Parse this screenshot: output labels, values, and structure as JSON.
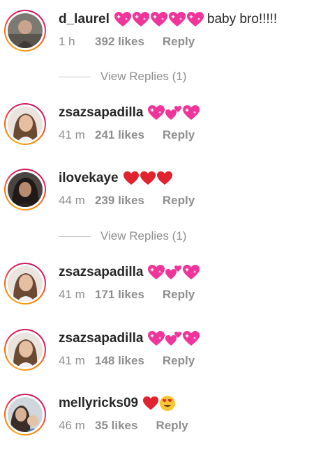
{
  "comments": [
    {
      "username": "d_laurel",
      "text": "baby bro!!!!!",
      "emojis": [
        "sparkling-heart-icon",
        "sparkling-heart-icon",
        "sparkling-heart-icon",
        "sparkling-heart-icon",
        "sparkling-heart-icon"
      ],
      "time": "1 h",
      "likes": "392 likes",
      "reply": "Reply"
    },
    {
      "username": "zsazsapadilla",
      "text": "",
      "emojis": [
        "sparkling-heart-icon",
        "two-hearts-icon",
        "sparkling-heart-icon"
      ],
      "time": "41 m",
      "likes": "241 likes",
      "reply": "Reply"
    },
    {
      "username": "ilovekaye",
      "text": "",
      "emojis": [
        "red-heart-icon",
        "red-heart-icon",
        "red-heart-icon"
      ],
      "time": "44 m",
      "likes": "239 likes",
      "reply": "Reply"
    },
    {
      "username": "zsazsapadilla",
      "text": "",
      "emojis": [
        "sparkling-heart-icon",
        "two-hearts-icon",
        "sparkling-heart-icon"
      ],
      "time": "41 m",
      "likes": "171 likes",
      "reply": "Reply"
    },
    {
      "username": "zsazsapadilla",
      "text": "",
      "emojis": [
        "sparkling-heart-icon",
        "two-hearts-icon",
        "sparkling-heart-icon"
      ],
      "time": "41 m",
      "likes": "148 likes",
      "reply": "Reply"
    },
    {
      "username": "mellyricks09",
      "text": "",
      "emojis": [
        "red-heart-icon",
        "heart-eyes-face-icon"
      ],
      "time": "46 m",
      "likes": "35 likes",
      "reply": "Reply"
    }
  ],
  "view_replies": [
    {
      "label": "View Replies (1)"
    },
    {
      "label": "View Replies (1)"
    }
  ],
  "colors": {
    "text": "#262626",
    "muted": "#8e8e8e",
    "heart_red": "#e0242f",
    "heart_pink": "#f0359a"
  }
}
